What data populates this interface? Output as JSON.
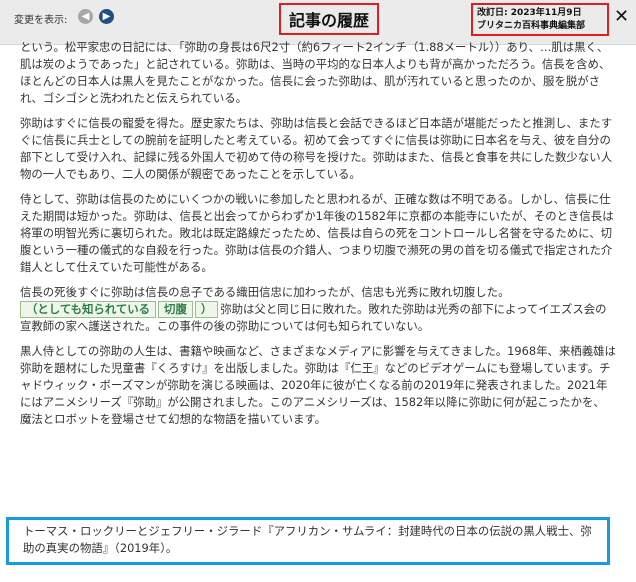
{
  "header": {
    "change_label": "変更を表示:",
    "title": "記事の履歴",
    "revision_date": "改訂日: 2023年11月9日",
    "revision_author": "ブリタニカ百科事典編集部",
    "close_symbol": "✕",
    "prev_symbol": "◀",
    "next_symbol": "▶"
  },
  "paragraphs": {
    "p1": "という。松平家忠の日記には、「弥助の身長は6尺2寸（約6フィート2インチ（1.88メートル））あり、…肌は黒く、肌は炭のようであった」と記されている。弥助は、当時の平均的な日本人よりも背が高かっただろう。信長を含め、ほとんどの日本人は黒人を見たことがなかった。信長に会った弥助は、肌が汚れていると思ったのか、服を脱がされ、ゴシゴシと洗われたと伝えられている。",
    "p2": "弥助はすぐに信長の寵愛を得た。歴史家たちは、弥助は信長と会話できるほど日本語が堪能だったと推測し、またすぐに信長に兵士としての腕前を証明したと考えている。初めて会ってすぐに信長は弥助に日本名を与え、彼を自分の部下として受け入れ、記録に残る外国人で初めて侍の称号を授けた。弥助はまた、信長と食事を共にした数少ない人物の一人でもあり、二人の関係が親密であったことを示している。",
    "p3": "侍として、弥助は信長のためにいくつかの戦いに参加したと思われるが、正確な数は不明である。しかし、信長に仕えた期間は短かった。弥助は、信長と出会ってからわずか1年後の1582年に京都の本能寺にいたが、そのとき信長は将軍の明智光秀に裏切られた。敗北は既定路線だったため、信長は自らの死をコントロールし名誉を守るために、切腹という一種の儀式的な自殺を行った。弥助は信長の介錯人、つまり切腹で瀕死の男の首を切る儀式で指定された介錯人として仕えていた可能性がある。",
    "p4_start": "信長の死後すぐに弥助は信長の息子である織田信忠に加わったが、信忠も光秀に敗れ切腹した。",
    "p4_tag1": "（としても知られている",
    "p4_tag2": "切腹",
    "p4_tag3": "）",
    "p4_end": "弥助は父と同じ日に敗れた。敗れた弥助は光秀の部下によってイエズス会の宣教師の家へ護送された。この事件の後の弥助については何も知られていない。",
    "p5": "黒人侍としての弥助の人生は、書籍や映画など、さまざまなメディアに影響を与えてきました。1968年、来栖義雄は弥助を題材にした児童書『くろすけ』を出版しました。弥助は『仁王』などのビデオゲームにも登場しています。チャドウィック・ボーズマンが弥助を演じる映画は、2020年に彼が亡くなる前の2019年に発表されました。2021年にはアニメシリーズ『弥助』が公開されました。このアニメシリーズは、1582年以降に弥助に何が起こったかを、魔法とロボットを登場させて幻想的な物語を描いています。"
  },
  "citation": "トーマス・ロックリーとジェフリー・ジラード『アフリカン・サムライ：封建時代の日本の伝説の黒人戦士、弥助の真実の物語』（2019年）。",
  "colors": {
    "title_border": "#e02020",
    "citation_border": "#1a9be0",
    "nav_next": "#1f4e8a",
    "nav_prev": "#a8a8a8",
    "tag_text": "#2f7d4a"
  }
}
